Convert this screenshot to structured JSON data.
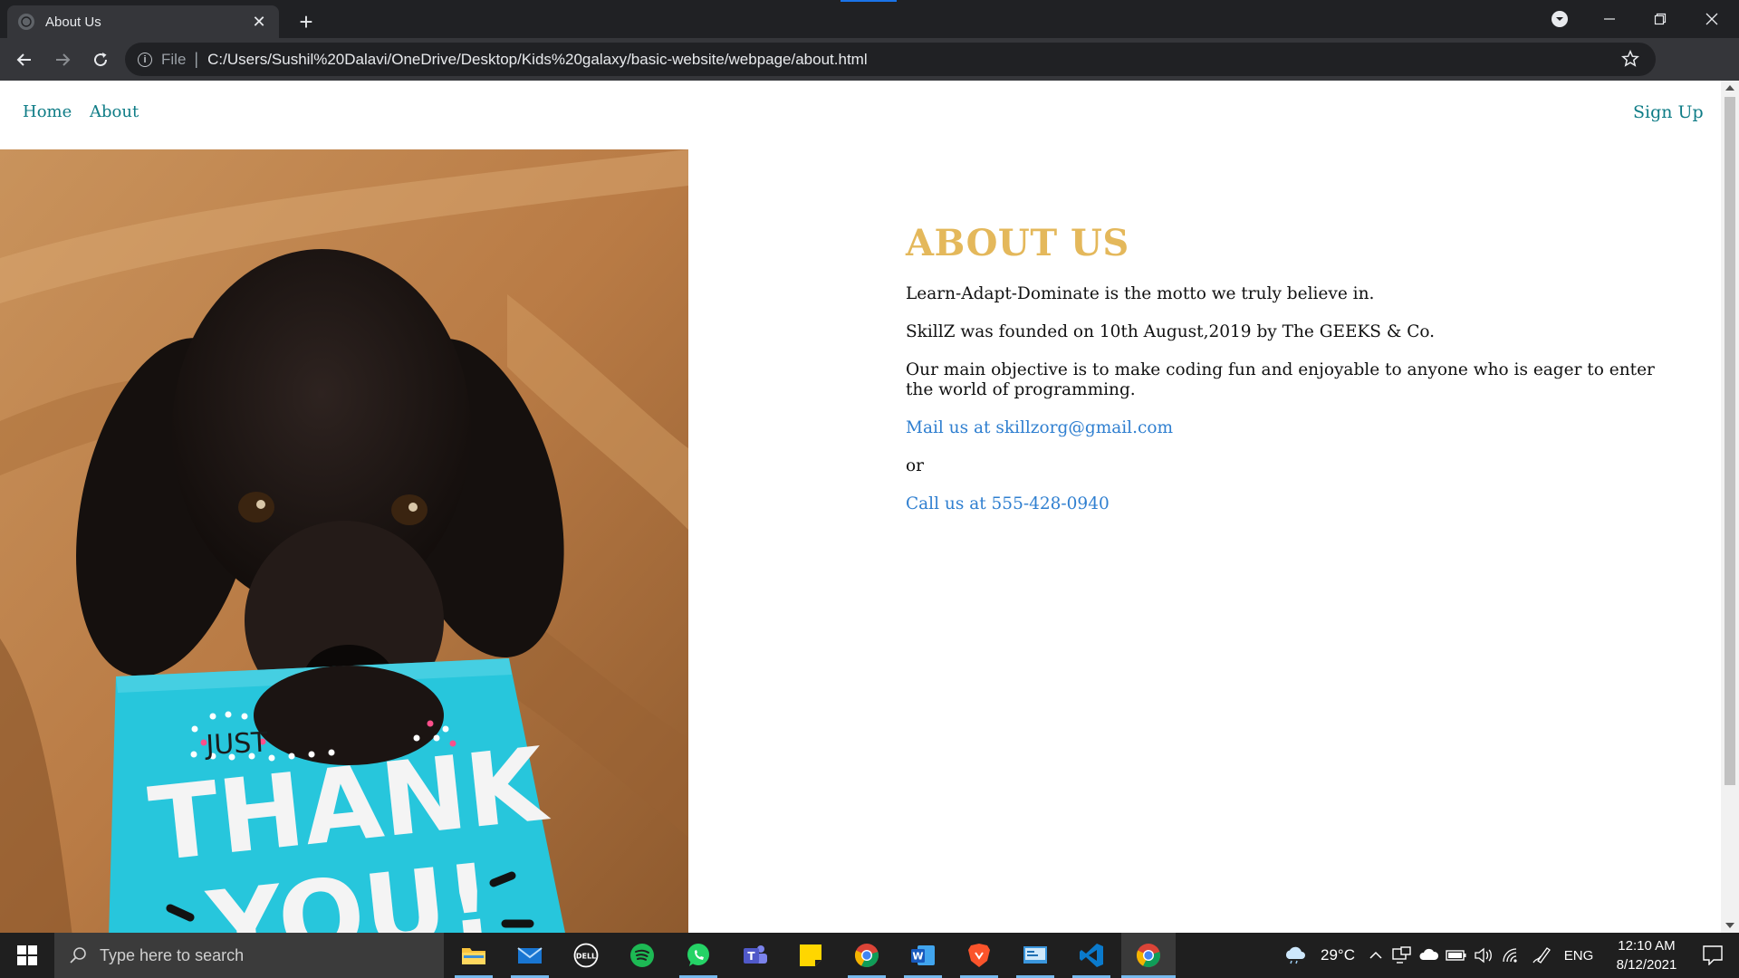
{
  "browser": {
    "tab_title": "About Us",
    "scheme_label": "File",
    "url": "C:/Users/Sushil%20Dalavi/OneDrive/Desktop/Kids%20galaxy/basic-website/webpage/about.html"
  },
  "nav": {
    "home": "Home",
    "about": "About",
    "signup": "Sign Up"
  },
  "about": {
    "heading": "ABOUT US",
    "motto": "Learn-Adapt-Dominate is the motto we truly believe in.",
    "founded": "SkillZ was founded on 10th August,2019 by The GEEKS & Co.",
    "objective": "Our main objective is to make coding fun and enjoyable to anyone who is eager to enter the world of programming.",
    "mail_link": "Mail us at skillzorg@gmail.com",
    "or_text": "or",
    "call_link": "Call us at 555-428-0940"
  },
  "hero_image": {
    "card_top_text": "JUST",
    "card_word1": "THANK",
    "card_word2": "YOU!"
  },
  "taskbar": {
    "search_placeholder": "Type here to search",
    "weather": "29°C",
    "language": "ENG",
    "time": "12:10 AM",
    "date": "8/12/2021",
    "apps": [
      "file-explorer",
      "mail",
      "dell",
      "spotify",
      "whatsapp",
      "teams",
      "sticky-notes",
      "chrome",
      "word",
      "brave",
      "control-panel",
      "vscode",
      "chrome-active"
    ]
  },
  "colors": {
    "heading_gold": "#e4b85b",
    "nav_teal": "#0e7c86",
    "link_blue": "#2f7fd0",
    "card_cyan": "#27c6dc"
  }
}
